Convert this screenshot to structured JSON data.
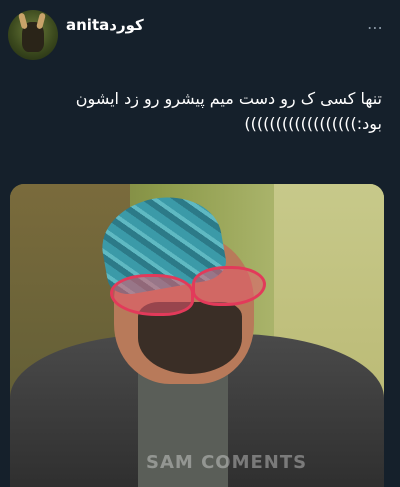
{
  "post": {
    "author": "anitaکورد",
    "more_icon": "⋯",
    "text": "تنها کسی ک رو دست میم پیشرو رو زد ایشون بود:))))))))))))))))))"
  },
  "media": {
    "watermark": "SAM COMENTS"
  }
}
